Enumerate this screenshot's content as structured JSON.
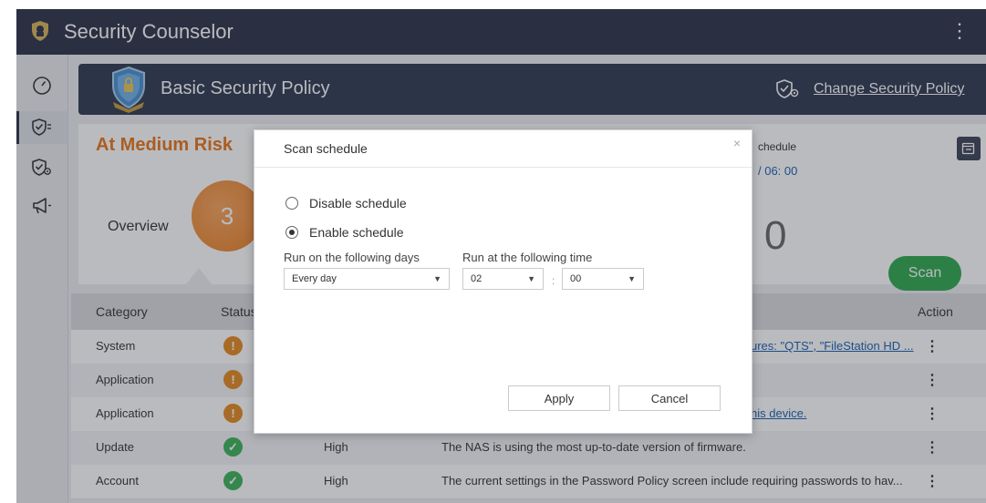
{
  "app": {
    "title": "Security Counselor",
    "menu_glyph": "⋮"
  },
  "sidebar": {
    "items": [
      {
        "icon": "dashboard-gauge-icon"
      },
      {
        "icon": "security-check-shield-icon",
        "active": true
      },
      {
        "icon": "shield-settings-icon"
      },
      {
        "icon": "announcement-megaphone-icon"
      }
    ]
  },
  "banner": {
    "title": "Basic Security Policy",
    "change_link": "Change Security Policy"
  },
  "summary": {
    "risk_title": "At Medium Risk",
    "overview_label": "Overview",
    "risk_count": "3",
    "schedule_label": "chedule",
    "schedule_time": "/ 06: 00",
    "partial_count": "0",
    "scan_label": "Scan"
  },
  "table": {
    "headers": {
      "category": "Category",
      "status": "Status",
      "action": "Action"
    },
    "rows": [
      {
        "category": "System",
        "status": "warning",
        "level": "",
        "description": "ures: \"QTS\", \"FileStation HD ...",
        "desc_link": true
      },
      {
        "category": "Application",
        "status": "warning",
        "level": "",
        "description": "",
        "desc_link": false
      },
      {
        "category": "Application",
        "status": "warning",
        "level": "",
        "description": "his device.",
        "desc_link": true
      },
      {
        "category": "Update",
        "status": "ok",
        "level": "High",
        "description": "The NAS is using the most up-to-date version of firmware.",
        "desc_link": false
      },
      {
        "category": "Account",
        "status": "ok",
        "level": "High",
        "description": "The current settings in the Password Policy screen include requiring passwords to hav...",
        "desc_link": false
      }
    ],
    "action_glyph": "⋮"
  },
  "dialog": {
    "title": "Scan schedule",
    "close_glyph": "×",
    "options": {
      "disable": "Disable schedule",
      "enable": "Enable schedule",
      "selected": "enable"
    },
    "days_label": "Run on the following days",
    "days_value": "Every day",
    "time_label": "Run at the following time",
    "hour_value": "02",
    "minute_value": "00",
    "colon": ":",
    "apply_label": "Apply",
    "cancel_label": "Cancel"
  },
  "colors": {
    "titlebar": "#2b3348",
    "banner": "#2f3852",
    "risk_orange": "#e8751a",
    "scan_green": "#2fa84f",
    "warning": "#e58a1f",
    "ok": "#3cb35a",
    "link": "#1a5fb4"
  }
}
